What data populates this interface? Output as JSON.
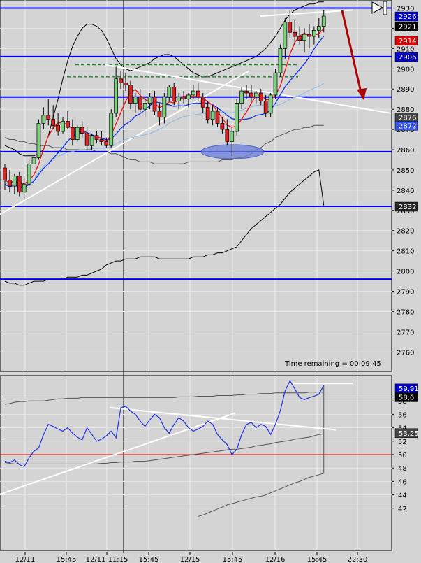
{
  "chart_data": [
    {
      "type": "candlestick",
      "panel": "price",
      "y_ticks": [
        2930,
        2920,
        2910,
        2900,
        2890,
        2880,
        2870,
        2860,
        2850,
        2840,
        2830,
        2820,
        2810,
        2800,
        2790,
        2780,
        2770,
        2760
      ],
      "ylim": [
        2752,
        2934
      ],
      "x_tick_labels": [
        "12/11",
        "15:45",
        "12/11 11:15",
        "15:45",
        "12/15",
        "15:45",
        "12/16",
        "15:45",
        "22:30"
      ],
      "time_remaining": "Time remaining = 00:09:45",
      "horizontal_levels": [
        2930,
        2906,
        2886,
        2859,
        2832,
        2796
      ],
      "price_tags": [
        {
          "text": "2926",
          "value": 2926,
          "bg": "#0000cc",
          "fg": "#ffffff"
        },
        {
          "text": "2921",
          "value": 2921,
          "bg": "#000000",
          "fg": "#ffffff"
        },
        {
          "text": "2914",
          "value": 2914,
          "bg": "#dd0000",
          "fg": "#ffffff"
        },
        {
          "text": "2906",
          "value": 2906,
          "bg": "#0000cc",
          "fg": "#ffffff"
        },
        {
          "text": "2876",
          "value": 2876,
          "bg": "#444444",
          "fg": "#ffffff"
        },
        {
          "text": "2872",
          "value": 2872,
          "bg": "#3355ee",
          "fg": "#ffffff"
        },
        {
          "text": "2832",
          "value": 2832,
          "bg": "#222222",
          "fg": "#ffffff"
        }
      ],
      "candles": [
        [
          2851,
          2853,
          2840,
          2845
        ],
        [
          2845,
          2850,
          2839,
          2842
        ],
        [
          2842,
          2848,
          2838,
          2847
        ],
        [
          2847,
          2849,
          2837,
          2839
        ],
        [
          2839,
          2846,
          2835,
          2843
        ],
        [
          2843,
          2856,
          2842,
          2853
        ],
        [
          2853,
          2858,
          2850,
          2856
        ],
        [
          2856,
          2875,
          2855,
          2873
        ],
        [
          2873,
          2881,
          2870,
          2877
        ],
        [
          2877,
          2885,
          2872,
          2875
        ],
        [
          2875,
          2882,
          2870,
          2872
        ],
        [
          2872,
          2878,
          2867,
          2869
        ],
        [
          2869,
          2876,
          2868,
          2874
        ],
        [
          2874,
          2879,
          2870,
          2871
        ],
        [
          2871,
          2875,
          2862,
          2865
        ],
        [
          2865,
          2872,
          2864,
          2871
        ],
        [
          2871,
          2874,
          2866,
          2868
        ],
        [
          2868,
          2871,
          2860,
          2862
        ],
        [
          2862,
          2868,
          2860,
          2867
        ],
        [
          2867,
          2869,
          2863,
          2865
        ],
        [
          2865,
          2869,
          2862,
          2864
        ],
        [
          2864,
          2866,
          2861,
          2862
        ],
        [
          2862,
          2880,
          2861,
          2878
        ],
        [
          2878,
          2901,
          2876,
          2895
        ],
        [
          2895,
          2899,
          2890,
          2893
        ],
        [
          2893,
          2898,
          2889,
          2892
        ],
        [
          2892,
          2894,
          2880,
          2883
        ],
        [
          2883,
          2888,
          2878,
          2886
        ],
        [
          2886,
          2890,
          2878,
          2880
        ],
        [
          2880,
          2886,
          2876,
          2883
        ],
        [
          2883,
          2888,
          2880,
          2886
        ],
        [
          2886,
          2889,
          2877,
          2879
        ],
        [
          2879,
          2883,
          2872,
          2876
        ],
        [
          2876,
          2888,
          2873,
          2886
        ],
        [
          2886,
          2892,
          2884,
          2891
        ],
        [
          2891,
          2893,
          2882,
          2884
        ],
        [
          2884,
          2888,
          2880,
          2886
        ],
        [
          2886,
          2889,
          2883,
          2885
        ],
        [
          2885,
          2888,
          2881,
          2887
        ],
        [
          2887,
          2892,
          2885,
          2889
        ],
        [
          2889,
          2893,
          2884,
          2886
        ],
        [
          2886,
          2888,
          2878,
          2881
        ],
        [
          2881,
          2884,
          2873,
          2875
        ],
        [
          2875,
          2882,
          2872,
          2879
        ],
        [
          2879,
          2881,
          2871,
          2873
        ],
        [
          2873,
          2876,
          2868,
          2870
        ],
        [
          2870,
          2875,
          2862,
          2864
        ],
        [
          2864,
          2871,
          2857,
          2869
        ],
        [
          2869,
          2885,
          2867,
          2883
        ],
        [
          2883,
          2891,
          2880,
          2889
        ],
        [
          2889,
          2892,
          2885,
          2888
        ],
        [
          2888,
          2892,
          2884,
          2886
        ],
        [
          2886,
          2889,
          2883,
          2888
        ],
        [
          2888,
          2890,
          2882,
          2884
        ],
        [
          2884,
          2887,
          2876,
          2878
        ],
        [
          2878,
          2888,
          2876,
          2887
        ],
        [
          2887,
          2900,
          2885,
          2898
        ],
        [
          2898,
          2912,
          2896,
          2910
        ],
        [
          2910,
          2925,
          2905,
          2923
        ],
        [
          2923,
          2929,
          2915,
          2918
        ],
        [
          2918,
          2924,
          2912,
          2916
        ],
        [
          2916,
          2921,
          2912,
          2914
        ],
        [
          2914,
          2920,
          2908,
          2917
        ],
        [
          2917,
          2922,
          2910,
          2916
        ],
        [
          2916,
          2921,
          2912,
          2919
        ],
        [
          2919,
          2925,
          2915,
          2921
        ],
        [
          2921,
          2929,
          2918,
          2926
        ]
      ],
      "annotations": {
        "down_arrow_color": "#aa0000",
        "ellipse_fill": "#6a7fd8",
        "support_lines_color": "#ffffff",
        "dashed_levels_color": "#1f8b3a",
        "dashed_levels": [
          2902,
          2896
        ]
      }
    },
    {
      "type": "line",
      "panel": "oscillator",
      "y_ticks": [
        58,
        56,
        54,
        52,
        50,
        48,
        46,
        44,
        42
      ],
      "ylim": [
        41,
        61
      ],
      "reference_level": 50,
      "reference_color": "#dd0000",
      "price_tags": [
        {
          "text": "59,91",
          "value": 59.91,
          "bg": "#0000cc",
          "fg": "#ffffff"
        },
        {
          "text": "58,6",
          "value": 58.6,
          "bg": "#000000",
          "fg": "#ffffff"
        },
        {
          "text": "53,25",
          "value": 53.25,
          "bg": "#444444",
          "fg": "#ffffff"
        }
      ],
      "series": [
        {
          "color": "#2233ee",
          "values": [
            49.0,
            48.8,
            49.2,
            48.5,
            48.2,
            49.5,
            50.5,
            51.0,
            53.0,
            54.5,
            54.2,
            53.8,
            53.5,
            54.0,
            53.2,
            52.6,
            52.2,
            54.0,
            53.0,
            52.0,
            52.3,
            52.8,
            53.5,
            52.5,
            57.0,
            57.2,
            56.5,
            56.0,
            55.0,
            54.2,
            55.2,
            56.0,
            55.5,
            54.0,
            53.2,
            54.5,
            55.5,
            55.0,
            54.0,
            53.5,
            53.8,
            54.2,
            55.0,
            54.5,
            53.0,
            52.2,
            51.5,
            50.0,
            50.8,
            53.0,
            54.5,
            54.8,
            54.0,
            54.5,
            54.2,
            53.0,
            54.5,
            56.5,
            59.5,
            61.0,
            59.8,
            58.5,
            58.2,
            58.5,
            58.7,
            59.0,
            60.3
          ]
        }
      ],
      "annotations": {
        "resistance_level": 60.6
      }
    }
  ]
}
